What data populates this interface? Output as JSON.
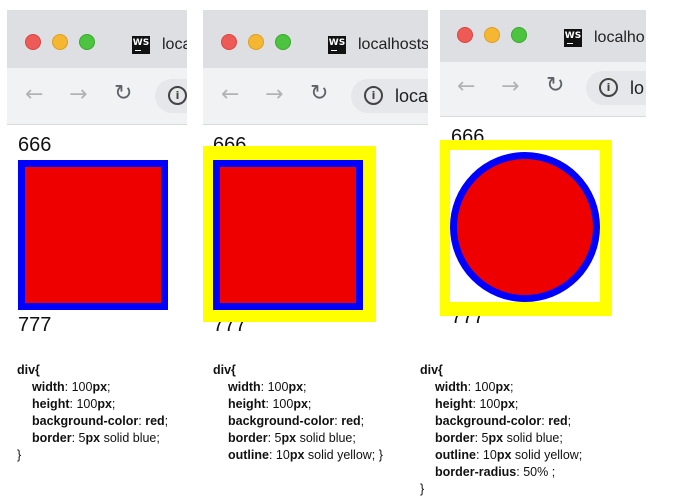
{
  "panels": [
    {
      "tab_title": "local",
      "url": "",
      "content_top": "666",
      "content_bottom": "777",
      "box": {
        "background": "#ee0000",
        "border_color": "#0000ff",
        "outline_color": "",
        "shape": "square"
      }
    },
    {
      "tab_title": "localhosts",
      "url": "loca",
      "content_top": "666",
      "content_bottom": "777",
      "box": {
        "background": "#ee0000",
        "border_color": "#0000ff",
        "outline_color": "#ffff00",
        "shape": "square"
      }
    },
    {
      "tab_title": "localho",
      "url": "lo",
      "content_top": "666",
      "content_bottom": "777",
      "box": {
        "background": "#ee0000",
        "border_color": "#0000ff",
        "outline_color": "#ffff00",
        "shape": "circle"
      }
    }
  ],
  "icons": {
    "logo": "webstorm-logo",
    "back": "back-arrow-icon",
    "forward": "forward-arrow-icon",
    "reload": "reload-icon",
    "info": "info-icon"
  },
  "logo_text": "WS",
  "info_glyph": "i",
  "code_blocks": [
    {
      "selector": "div{",
      "lines": [
        {
          "prop": "width",
          "value": "100",
          "unit": "px",
          "rest": ";"
        },
        {
          "prop": "height",
          "value": "100",
          "unit": "px",
          "rest": ";"
        },
        {
          "prop": "background-color",
          "value": "",
          "unit": "red",
          "rest": ";"
        },
        {
          "prop": "border",
          "value": "5",
          "unit": "px",
          "rest": " solid blue;"
        }
      ],
      "closing": "}"
    },
    {
      "selector": "div{",
      "lines": [
        {
          "prop": "width",
          "value": "100",
          "unit": "px",
          "rest": ";"
        },
        {
          "prop": "height",
          "value": "100",
          "unit": "px",
          "rest": ";"
        },
        {
          "prop": "background-color",
          "value": "",
          "unit": "red",
          "rest": ";"
        },
        {
          "prop": "border",
          "value": "5",
          "unit": "px",
          "rest": " solid blue;"
        },
        {
          "prop": "outline",
          "value": "10",
          "unit": "px",
          "rest": " solid yellow; }"
        }
      ],
      "closing": ""
    },
    {
      "selector": "div{",
      "lines": [
        {
          "prop": "width",
          "value": "100",
          "unit": "px",
          "rest": ";"
        },
        {
          "prop": "height",
          "value": "100",
          "unit": "px",
          "rest": ";"
        },
        {
          "prop": "background-color",
          "value": "",
          "unit": "red",
          "rest": ";"
        },
        {
          "prop": "border",
          "value": "5",
          "unit": "px",
          "rest": " solid blue;"
        },
        {
          "prop": "outline",
          "value": "10",
          "unit": "px",
          "rest": " solid yellow;"
        },
        {
          "prop": "border-radius",
          "value": "50% ",
          "unit": "",
          "rest": ";"
        }
      ],
      "closing": "}"
    }
  ]
}
